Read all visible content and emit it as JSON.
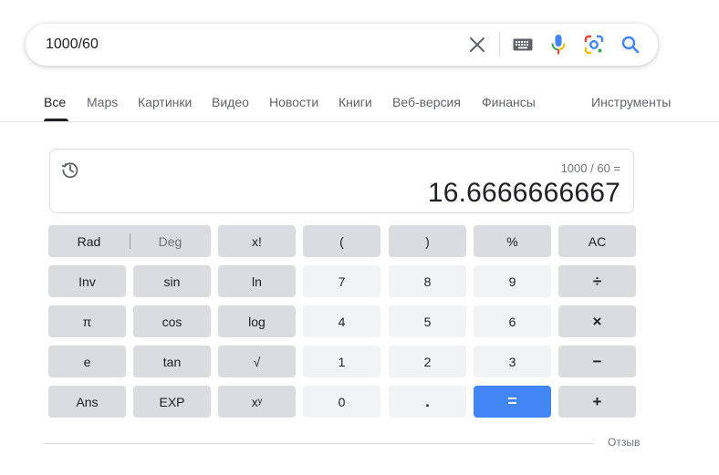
{
  "search": {
    "query": "1000/60",
    "icons": [
      "close-icon",
      "keyboard-icon",
      "mic-icon",
      "lens-icon",
      "search-icon"
    ]
  },
  "tabs": [
    {
      "label": "Все",
      "active": true
    },
    {
      "label": "Maps",
      "active": false
    },
    {
      "label": "Картинки",
      "active": false
    },
    {
      "label": "Видео",
      "active": false
    },
    {
      "label": "Новости",
      "active": false
    },
    {
      "label": "Книги",
      "active": false
    },
    {
      "label": "Веб-версия",
      "active": false
    },
    {
      "label": "Финансы",
      "active": false
    }
  ],
  "tools_label": "Инструменты",
  "calculator": {
    "expression": "1000 / 60 =",
    "result": "16.6666666667",
    "rad": "Rad",
    "deg": "Deg",
    "keys": {
      "fact": "x!",
      "lparen": "(",
      "rparen": ")",
      "percent": "%",
      "ac": "AC",
      "inv": "Inv",
      "sin": "sin",
      "ln": "ln",
      "d7": "7",
      "d8": "8",
      "d9": "9",
      "div": "÷",
      "pi": "π",
      "cos": "cos",
      "log": "log",
      "d4": "4",
      "d5": "5",
      "d6": "6",
      "mul": "×",
      "e": "e",
      "tan": "tan",
      "sqrt": "√",
      "d1": "1",
      "d2": "2",
      "d3": "3",
      "minus": "−",
      "ans": "Ans",
      "exp": "EXP",
      "pow": "xʸ",
      "d0": "0",
      "dot": ".",
      "eq": "=",
      "plus": "+"
    }
  },
  "feedback_label": "Отзыв",
  "colors": {
    "accent": "#4285f4",
    "key_dark": "#dadce0",
    "key_light": "#f1f3f4"
  }
}
